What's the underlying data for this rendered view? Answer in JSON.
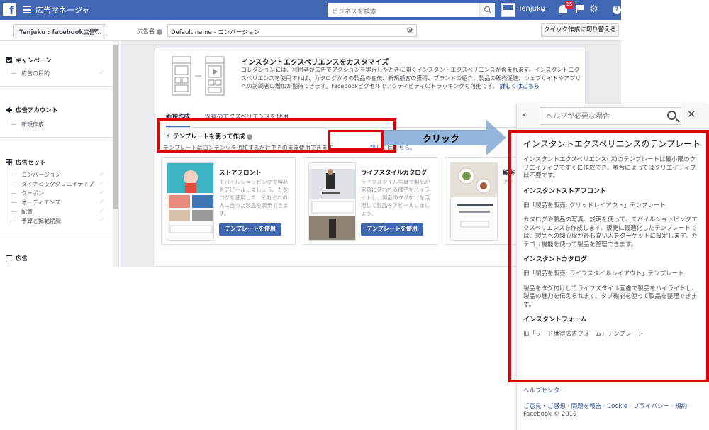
{
  "topbar": {
    "app_title": "広告マネージャ",
    "search_placeholder": "ビジネスを検索",
    "user_name": "Tenjuku",
    "notification_count": "15"
  },
  "subbar": {
    "account_name": "Tenjuku : facebook広告...",
    "ad_name_label": "広告名",
    "ad_name_value": "Default name - コンバージョン",
    "quick_create_label": "クイック作成に切り替える"
  },
  "nav": {
    "campaign": {
      "label": "キャンペーン",
      "items": [
        "広告の目的"
      ]
    },
    "account": {
      "label": "広告アカウント",
      "items": [
        "新規作成"
      ]
    },
    "adset": {
      "label": "広告セット",
      "items": [
        "コンバージョン",
        "ダイナミッククリエイティブ",
        "クーポン",
        "オーディエンス",
        "配置",
        "予算と掲載期間"
      ]
    },
    "ad": {
      "label": "広告"
    }
  },
  "main": {
    "title": "インスタントエクスペリエンスをカスタマイズ",
    "description": "コレクションには、利用者が広告でアクションを実行したときに開くインスタントエクスペリエンスが含まれます。インスタントエクスペリエンスを使用すれば、カタログからの製品の宣伝、新規顧客の獲得、ブランドの紹介、製品の販売促進、ウェブサイトやアプリへの訪問者の増加が期待できます。Facebookピクセルでアクティビティのトラッキングも可能です。",
    "description_link": "詳しくはこちら",
    "tabs": [
      "新規作成",
      "既存のエクスペリエンスを使用"
    ],
    "template_title": "テンプレートを使って作成",
    "template_desc": "テンプレートはコンテンツを追加するだけでそのまま使用できます。",
    "template_link": "詳しくはこちら。",
    "templates": [
      {
        "title": "ストアフロント",
        "text": "モバイルショッピングで製品をアピールしましょう。カタログを使用して、それぞれの人に合った製品を表示できます。",
        "button": "テンプレートを使用"
      },
      {
        "title": "ライフスタイルカタログ",
        "text": "ライフスタイル写真で製品が実際に使われる様子をハイライトし、製品のタグ付けを活用して製品をアピールしましょう。",
        "button": "テンプレートを使用"
      },
      {
        "title": "顧客",
        "text": "アク",
        "button": ""
      }
    ]
  },
  "annotation": {
    "click_label": "クリック"
  },
  "help": {
    "search_placeholder": "ヘルプが必要な場合",
    "title": "インスタントエクスペリエンスのテンプレート",
    "intro": "インスタントエクスペリエンス(IX)のテンプレートは最小限のクリエイティブですぐに作成でき、場合によってはクリエイティブは不要です。",
    "s1_title": "インスタントストアフロント",
    "s1_p1": "旧「製品を販売: グリッドレイアウト」テンプレート",
    "s1_p2": "カタログや製品の写真、説明を使って、モバイルショッピングエクスペリエンスを作成します。販売に最適化したテンプレートでは、製品への関心度が最も高い人をターゲットに設定します。カテゴリ機能を使って製品を整理できます。",
    "s2_title": "インスタントカタログ",
    "s2_p1": "旧「製品を販売: ライフスタイルレイアウト」テンプレート",
    "s2_p2": "製品をタグ付けしてライフスタイル画像で製品をハイライトし、製品の魅力を伝えられます。タブ機能を使って製品を整理できます。",
    "s3_title": "インスタントフォーム",
    "s3_p1": "旧「リード獲得広告フォーム」テンプレート",
    "footer_help": "ヘルプセンター",
    "footer_links": "ご意見・ご感想 · 問題を報告 · Cookie · プライバシー · 規約",
    "copyright": "Facebook © 2019"
  }
}
